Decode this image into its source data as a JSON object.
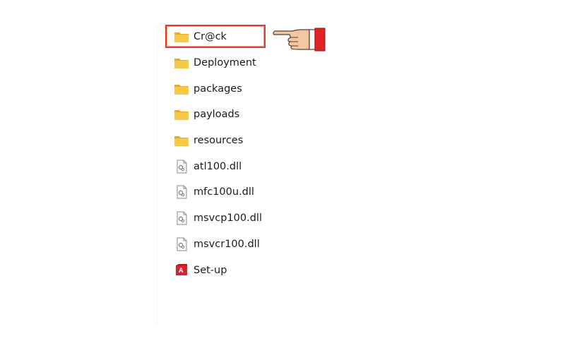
{
  "explorer": {
    "items": [
      {
        "name": "Cr@ck",
        "type": "folder",
        "icon": "folder-icon",
        "highlighted": true
      },
      {
        "name": "Deployment",
        "type": "folder",
        "icon": "folder-icon"
      },
      {
        "name": "packages",
        "type": "folder",
        "icon": "folder-icon"
      },
      {
        "name": "payloads",
        "type": "folder",
        "icon": "folder-icon"
      },
      {
        "name": "resources",
        "type": "folder",
        "icon": "folder-icon"
      },
      {
        "name": "atl100.dll",
        "type": "dll",
        "icon": "dll-file-icon"
      },
      {
        "name": "mfc100u.dll",
        "type": "dll",
        "icon": "dll-file-icon"
      },
      {
        "name": "msvcp100.dll",
        "type": "dll",
        "icon": "dll-file-icon"
      },
      {
        "name": "msvcr100.dll",
        "type": "dll",
        "icon": "dll-file-icon"
      },
      {
        "name": "Set-up",
        "type": "exe",
        "icon": "adobe-setup-icon"
      }
    ]
  },
  "colors": {
    "highlight_border": "#e8372f",
    "highlight_inner": "#f4a46a",
    "folder_yellow": "#f7c948",
    "adobe_red": "#d7242a",
    "hand_skin": "#f3c7a2",
    "sleeve_red": "#e02424"
  }
}
